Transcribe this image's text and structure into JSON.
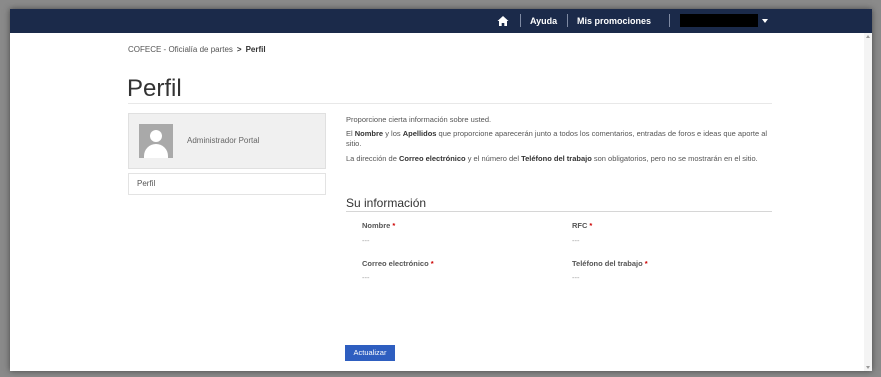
{
  "nav": {
    "help_label": "Ayuda",
    "promotions_label": "Mis promociones",
    "home_icon": "home-icon",
    "bar_color": "#1b2a4a"
  },
  "breadcrumb": {
    "parent": "COFECE - Oficialía de partes",
    "separator": ">",
    "current": "Perfil"
  },
  "page": {
    "title": "Perfil"
  },
  "sidebar": {
    "user_name": "Administrador Portal",
    "avatar_icon": "user-silhouette-icon",
    "items": [
      {
        "label": "Perfil"
      }
    ]
  },
  "intro": {
    "line1": "Proporcione cierta información sobre usted.",
    "line2": {
      "pre": "El ",
      "b1": "Nombre",
      "mid": " y los ",
      "b2": "Apellidos",
      "post": " que proporcione aparecerán junto a todos los comentarios, entradas de foros e ideas que aporte al sitio."
    },
    "line3": {
      "pre": "La dirección de ",
      "b1": "Correo electrónico",
      "mid": " y el número del ",
      "b2": "Teléfono del trabajo",
      "post": " son obligatorios, pero no se mostrarán en el sitio."
    }
  },
  "section": {
    "title": "Su información"
  },
  "fields": [
    {
      "label": "Nombre",
      "required": "*",
      "value": "---"
    },
    {
      "label": "RFC",
      "required": "*",
      "value": "---"
    },
    {
      "label": "Correo electrónico",
      "required": "*",
      "value": "---"
    },
    {
      "label": "Teléfono del trabajo",
      "required": "*",
      "value": "---"
    }
  ],
  "actions": {
    "update_label": "Actualizar",
    "button_color": "#2e5ec0"
  }
}
